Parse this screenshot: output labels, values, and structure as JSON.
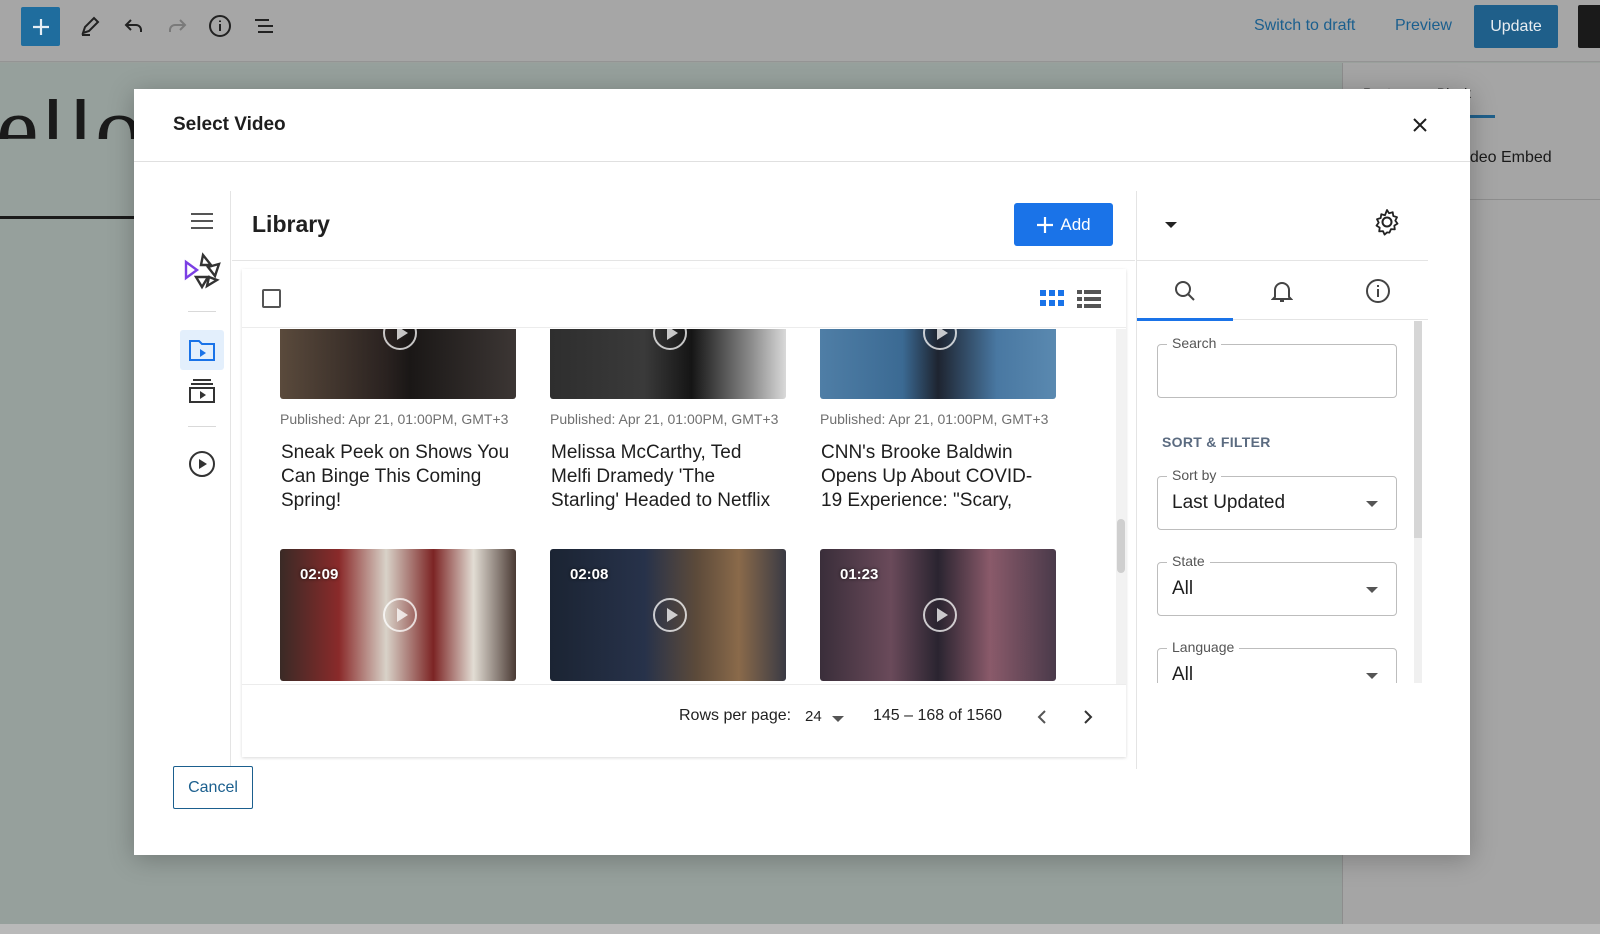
{
  "editor": {
    "page_title": "ello world!",
    "toolbar": {
      "switch_to_draft": "Switch to draft",
      "preview": "Preview",
      "update": "Update"
    },
    "sidebar": {
      "tab_post": "Post",
      "tab_block": "Block",
      "block_name": ": Video Embed"
    }
  },
  "modal": {
    "title": "Select Video",
    "cancel": "Cancel",
    "library": {
      "title": "Library",
      "add_label": "Add",
      "videos": [
        {
          "published": "Published: Apr 21, 01:00PM, GMT+3",
          "title": "Sneak Peek on Shows You Can Binge This Coming Spring!",
          "duration": ""
        },
        {
          "published": "Published: Apr 21, 01:00PM, GMT+3",
          "title": "Melissa McCarthy, Ted Melfi Dramedy 'The Starling' Headed to Netflix",
          "duration": ""
        },
        {
          "published": "Published: Apr 21, 01:00PM, GMT+3",
          "title": "CNN's Brooke Baldwin Opens Up About COVID-19 Experience: \"Scary,",
          "duration": ""
        },
        {
          "published": "",
          "title": "",
          "duration": "02:09"
        },
        {
          "published": "",
          "title": "",
          "duration": "02:08"
        },
        {
          "published": "",
          "title": "",
          "duration": "01:23"
        }
      ],
      "pagination": {
        "rows_label": "Rows per page:",
        "rows_value": "24",
        "range": "145 – 168 of 1560"
      }
    },
    "filters": {
      "search_label": "Search",
      "search_value": "",
      "section": "SORT & FILTER",
      "sort_label": "Sort by",
      "sort_value": "Last Updated",
      "state_label": "State",
      "state_value": "All",
      "language_label": "Language",
      "language_value": "All"
    }
  },
  "colors": {
    "accent": "#1a73e8",
    "wp_blue": "#1f5f8a"
  }
}
